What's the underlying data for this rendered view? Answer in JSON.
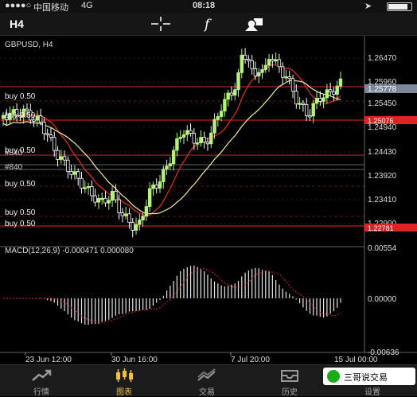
{
  "status_bar": {
    "carrier": "中国移动",
    "network": "4G",
    "time": "08:18"
  },
  "toolbar": {
    "timeframe": "H4",
    "crosshair_icon": "crosshair-icon",
    "indicator_icon": "function-icon",
    "objects_icon": "shapes-icon"
  },
  "chart": {
    "symbol_label": "GBPUSD, H4",
    "price_ticks": [
      "1.26470",
      "1.25960",
      "1.25450",
      "1.24940",
      "1.24430",
      "1.23920",
      "1.23410",
      "1.22900"
    ],
    "current_price": "1.25778",
    "marker_prices": [
      "1.25076",
      "1.22781"
    ],
    "order_labels": [
      "buy 0.50",
      "buy 0.50",
      "buy 0.50",
      "buy 0.50",
      "buy 0.50",
      "buy 0.50"
    ],
    "overlap_labels": [
      "#840",
      "#840"
    ],
    "macd_label": "MACD(12,26,9) -0.000471 0.000080",
    "macd_ticks": [
      "0.00554",
      "0.00000",
      "-0.00636"
    ],
    "time_labels": [
      "23 Jun 12:00",
      "30 Jun 16:00",
      "7 Jul 20:00",
      "15 Jul 00:00"
    ],
    "colors": {
      "bull": "#b6f27a",
      "bear": "#ffffff",
      "ma_fast": "#d62a2a",
      "ma_slow": "#f4ee9c",
      "order_line": "#c83030",
      "price_line": "#ee2222",
      "grid": "#444444",
      "current_price_bg": "#7c8799"
    }
  },
  "tabbar": {
    "tabs": [
      {
        "label": "行情",
        "icon": "quotes-icon"
      },
      {
        "label": "图表",
        "icon": "chart-icon",
        "active": true
      },
      {
        "label": "交易",
        "icon": "trade-icon"
      },
      {
        "label": "历史",
        "icon": "history-icon"
      },
      {
        "label": "设置",
        "icon": "settings-icon"
      }
    ]
  },
  "watermark": "三哥说交易"
}
